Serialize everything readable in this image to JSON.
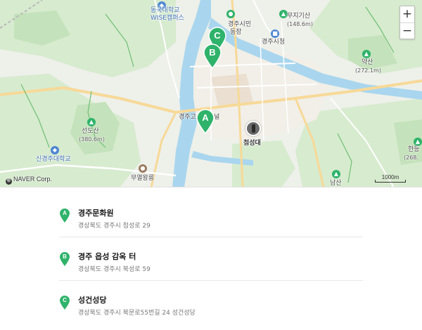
{
  "map": {
    "labels": {
      "dongguk": "동국대학교",
      "wise": "WISE캠퍼스",
      "gyeongju_market": "경주시민",
      "dong": "동장",
      "city_hall": "경주시청",
      "mujigisan": "무지기산",
      "mujigisan_height": "(148.6m)",
      "yaksan": "약산",
      "yaksan_height": "(272.1m)",
      "seondosan": "선도산",
      "seondosan_height": "(380.6m)",
      "sin_gyeongju_univ": "신경주대학교",
      "muyeol_tomb": "무열왕릉",
      "gyeongju_go": "경주고",
      "gyeongju_go_tail": "널",
      "cheomseongdae": "첨성대",
      "namsan": "남산",
      "handeung": "한등",
      "handeung_height": "(268."
    },
    "markers": [
      {
        "letter": "A",
        "color": "#2fb36b"
      },
      {
        "letter": "B",
        "color": "#2fb36b"
      },
      {
        "letter": "C",
        "color": "#2fb36b"
      }
    ],
    "zoom_in": "+",
    "zoom_out": "−",
    "copyright": "NAVER Corp.",
    "copyright_icon": "©",
    "scale": "1000m",
    "colors": {
      "water": "#a9d6ee",
      "park": "#c9e6c1",
      "road": "#ffffff",
      "major_road": "#f7d998",
      "marker": "#2fb36b"
    }
  },
  "places": [
    {
      "letter": "A",
      "name": "경주문화원",
      "address": "경상북도 경주시 첨성로 29"
    },
    {
      "letter": "B",
      "name": "경주 읍성 감옥 터",
      "address": "경상북도 경주시 북성로 59"
    },
    {
      "letter": "C",
      "name": "성건성당",
      "address": "경상북도 경주시 북문로55번길 24 성건성당"
    }
  ]
}
